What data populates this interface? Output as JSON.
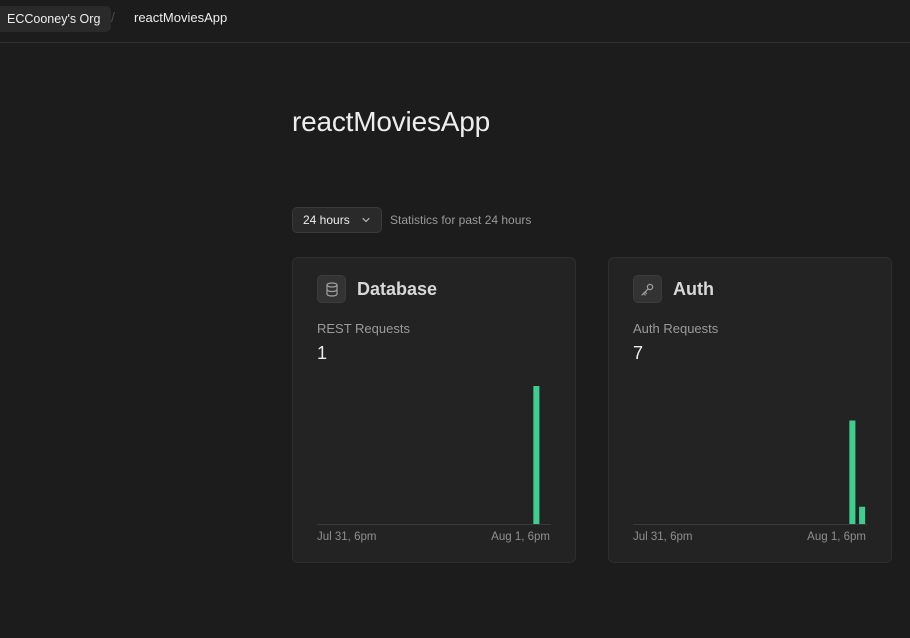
{
  "breadcrumb": {
    "org": "ECCooney's Org",
    "separator": "/",
    "project": "reactMoviesApp"
  },
  "page": {
    "title": "reactMoviesApp"
  },
  "range": {
    "selected": "24 hours",
    "caption": "Statistics for past 24 hours"
  },
  "colors": {
    "bar": "#3ecf8e",
    "baseline": "#3a3a3a"
  },
  "cards": {
    "database": {
      "icon": "database-icon",
      "title": "Database",
      "metric_label": "REST Requests",
      "metric_value": "1",
      "axis_start": "Jul 31, 6pm",
      "axis_end": "Aug 1, 6pm"
    },
    "auth": {
      "icon": "key-icon",
      "title": "Auth",
      "metric_label": "Auth Requests",
      "metric_value": "7",
      "axis_start": "Jul 31, 6pm",
      "axis_end": "Aug 1, 6pm"
    }
  },
  "chart_data": [
    {
      "type": "bar",
      "name": "REST Requests",
      "bucket_count": 24,
      "bars": [
        {
          "bucket": 22,
          "value": 1
        }
      ],
      "ymax": 1
    },
    {
      "type": "bar",
      "name": "Auth Requests",
      "bucket_count": 24,
      "bars": [
        {
          "bucket": 22,
          "value": 6
        },
        {
          "bucket": 23,
          "value": 1
        }
      ],
      "ymax": 8
    }
  ]
}
